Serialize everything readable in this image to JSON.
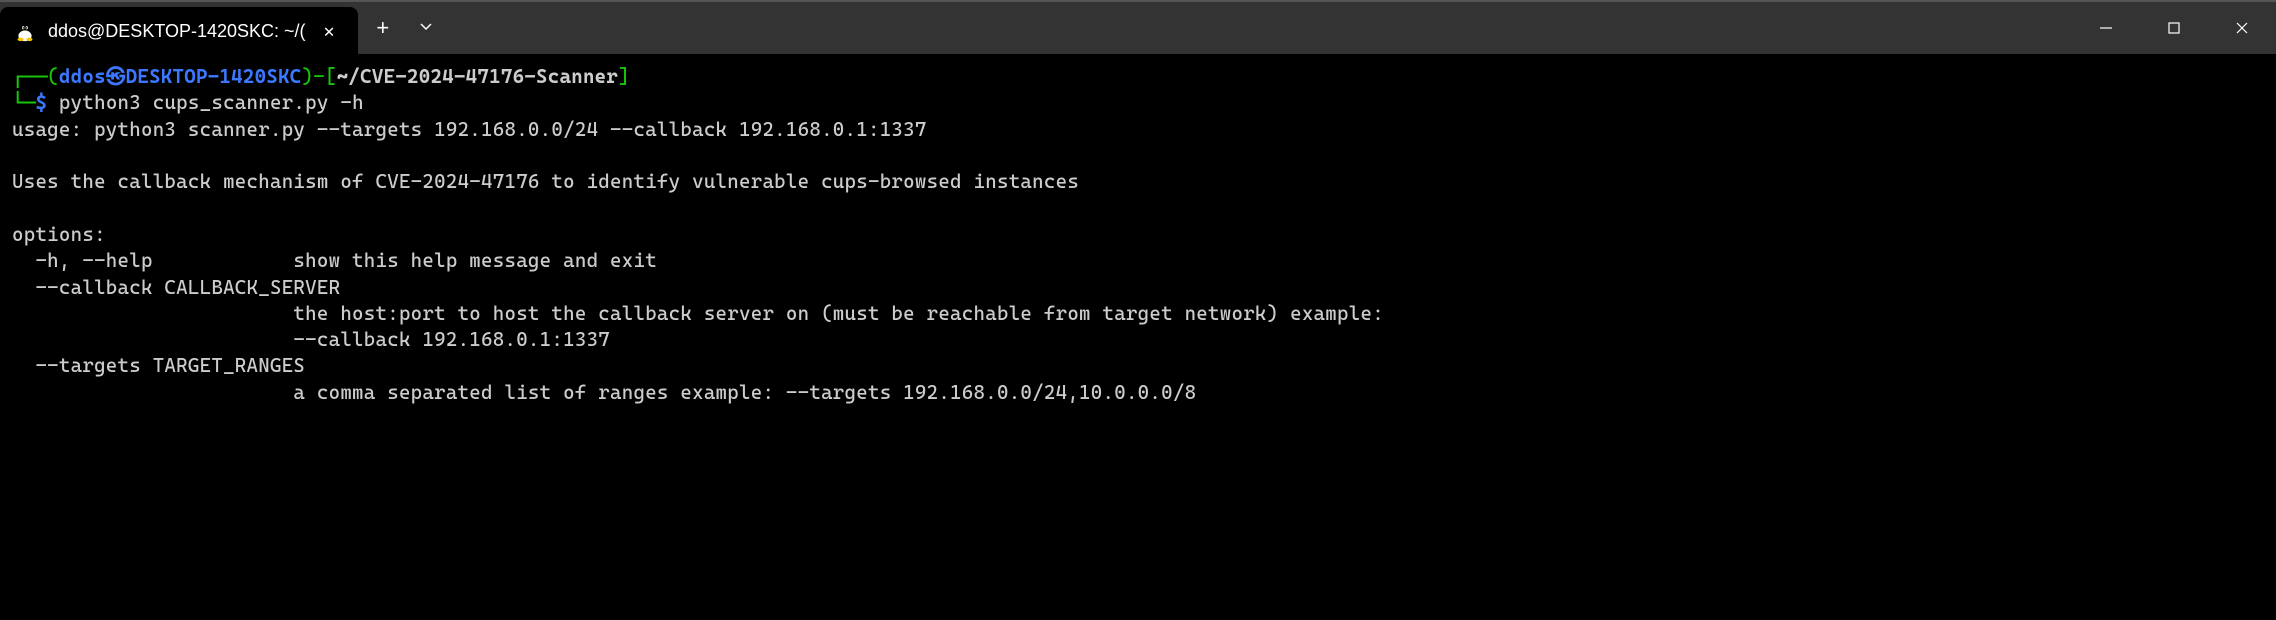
{
  "window": {
    "tab_title": "ddos@DESKTOP-1420SKC: ~/(",
    "tab_icon": "tux-icon"
  },
  "prompt": {
    "line_start": "┌──(",
    "user": "ddos",
    "at": "㉿",
    "host": "DESKTOP-1420SKC",
    "line_mid": ")-[",
    "path": "~/CVE-2024-47176-Scanner",
    "line_end": "]",
    "prompt_prefix": "└─",
    "prompt_symbol": "$",
    "command": "python3 cups_scanner.py -h"
  },
  "output": {
    "usage": "usage: python3 scanner.py --targets 192.168.0.0/24 --callback 192.168.0.1:1337",
    "blank1": "",
    "description": "Uses the callback mechanism of CVE-2024-47176 to identify vulnerable cups-browsed instances",
    "blank2": "",
    "options_header": "options:",
    "help_line": "  -h, --help            show this help message and exit",
    "callback_flag": "  --callback CALLBACK_SERVER",
    "callback_desc1": "                        the host:port to host the callback server on (must be reachable from target network) example:",
    "callback_desc2": "                        --callback 192.168.0.1:1337",
    "targets_flag": "  --targets TARGET_RANGES",
    "targets_desc": "                        a comma separated list of ranges example: --targets 192.168.0.0/24,10.0.0.0/8"
  }
}
